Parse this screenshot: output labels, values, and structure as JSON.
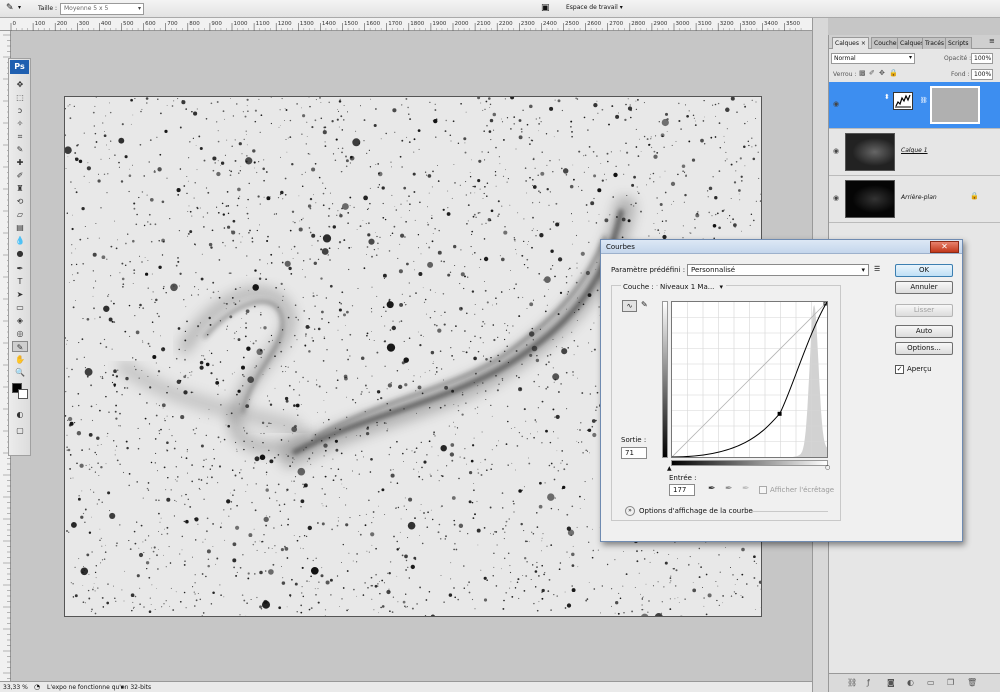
{
  "options_bar": {
    "size_label": "Taille :",
    "size_value": "Moyenne 5 x 5",
    "workspace_label": "Espace de travail"
  },
  "ruler": {
    "top_ticks": [
      "0",
      "100",
      "200",
      "300",
      "400",
      "500",
      "600",
      "700",
      "800",
      "900",
      "1000",
      "1100",
      "1200",
      "1300",
      "1400",
      "1500",
      "1600",
      "1700",
      "1800",
      "1900",
      "2000",
      "2100",
      "2200",
      "2300",
      "2400",
      "2500",
      "2600",
      "2700",
      "2800",
      "2900",
      "3000",
      "3100",
      "3200",
      "3300",
      "3400",
      "3500"
    ]
  },
  "toolbox": {
    "logo": "Ps"
  },
  "status": {
    "zoom": "33,33 %",
    "message": "L'expo ne fonctionne qu'en 32-bits"
  },
  "layers_panel": {
    "tabs": [
      "Calques",
      "Couches",
      "Calques",
      "Tracés",
      "Scripts"
    ],
    "close_glyph": "×",
    "blend_mode": "Normal",
    "opacity_label": "Opacité :",
    "opacity_value": "100%",
    "lock_label": "Verrou :",
    "fill_label": "Fond :",
    "fill_value": "100%",
    "layers": [
      {
        "name": "",
        "type": "curves-adjustment",
        "selected": true
      },
      {
        "name": "Calque 1",
        "type": "pixel",
        "selected": false
      },
      {
        "name": "Arrière-plan",
        "type": "background",
        "selected": false,
        "locked": true
      }
    ]
  },
  "curves_dialog": {
    "title": "Courbes",
    "preset_label": "Paramètre prédéfini :",
    "preset_value": "Personnalisé",
    "channel_label": "Couche :",
    "channel_value": "Niveaux 1 Ma...",
    "output_label": "Sortie :",
    "output_value": "71",
    "input_label": "Entrée :",
    "input_value": "177",
    "clip_label": "Afficher l'écrêtage",
    "display_options_label": "Options d'affichage de la courbe",
    "buttons": {
      "ok": "OK",
      "cancel": "Annuler",
      "smooth": "Lisser",
      "auto": "Auto",
      "options": "Options..."
    },
    "preview_label": "Aperçu",
    "preview_checked": true,
    "curve_point": {
      "input": 177,
      "output": 71
    }
  },
  "colors": {
    "selection_blue": "#3d8ef0",
    "dialog_border": "#6f8bb1",
    "close_red": "#c2381c"
  }
}
